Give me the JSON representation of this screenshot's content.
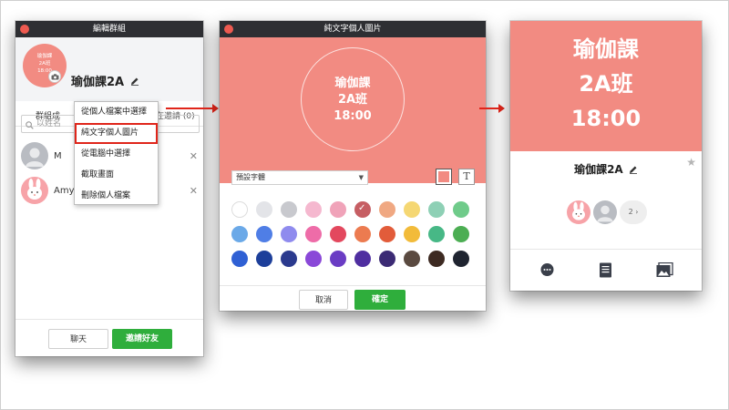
{
  "edit_group": {
    "title": "編輯群組",
    "avatar_text": [
      "瑜伽課",
      "2A班",
      "18:00"
    ],
    "group_name": "瑜伽課2A",
    "tab_members": "群組成",
    "tab_invited": "在邀請 (0)",
    "search_placeholder": "以姓名",
    "members": [
      {
        "name": "M",
        "avatar": "default-person"
      },
      {
        "name": "Amy",
        "avatar": "bunny"
      }
    ],
    "menu": [
      "從個人檔案中選擇",
      "純文字個人圖片",
      "從電腦中選擇",
      "截取畫面",
      "刪除個人檔案"
    ],
    "menu_highlight_index": 1,
    "chat_label": "聊天",
    "invite_label": "邀請好友"
  },
  "text_image": {
    "title": "純文字個人圖片",
    "preview_lines": [
      "瑜伽課",
      "2A班",
      "18:00"
    ],
    "font_select": "預設字體",
    "text_button": "T",
    "background_color": "#f28b82",
    "palette": [
      "#ffffff",
      "#e3e4e8",
      "#c8c9ce",
      "#f5b8cf",
      "#f0a3b9",
      "#c65e63",
      "#f0a882",
      "#f5d773",
      "#8ed0b5",
      "#6fcb8a",
      "#6ba9e8",
      "#4f7ee6",
      "#8f8bee",
      "#ee6ca8",
      "#e3485e",
      "#ec7b50",
      "#e25c3a",
      "#f2bb3a",
      "#47b886",
      "#4cae53",
      "#2f60d4",
      "#1d3f9a",
      "#2b3a8e",
      "#8a48d8",
      "#6a3cc4",
      "#4f2ea0",
      "#3b2a74",
      "#5a4a40",
      "#3d2a22",
      "#1f2430"
    ],
    "selected_index": 5,
    "cancel_label": "取消",
    "confirm_label": "確定"
  },
  "group_profile": {
    "cover_lines": [
      "瑜伽課",
      "2A班",
      "18:00"
    ],
    "group_name": "瑜伽課2A",
    "more_count": "2 ›"
  }
}
